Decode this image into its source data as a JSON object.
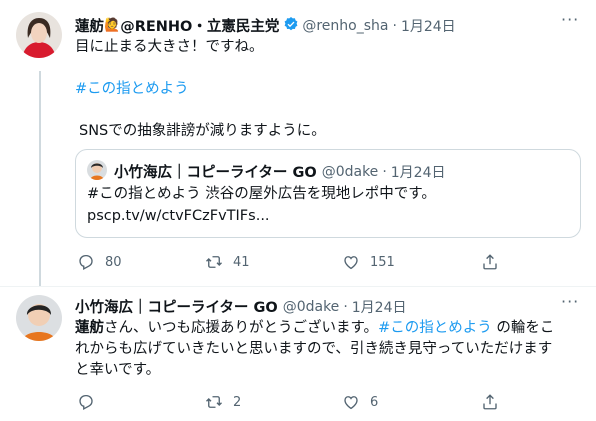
{
  "tweet1": {
    "display_name": "蓮舫",
    "name_emoji": "🙋",
    "party": "@RENHO・立憲民主党",
    "handle": "@renho_sha",
    "date": "1月24日",
    "text_line1": "目に止まる大きさ！ですね。",
    "hashtag": "#この指とめよう",
    "text_line3": "SNSでの抽象誹謗が減りますように。",
    "quote": {
      "display_name": "小竹海広｜コピーライター GO",
      "handle": "@0dake",
      "date": "1月24日",
      "hashtag": "#この指とめよう",
      "text": " 渋谷の屋外広告を現地レポ中です。",
      "link": "pscp.tv/w/ctvFCzFvTIFs..."
    },
    "reply_count": "80",
    "retweet_count": "41",
    "like_count": "151"
  },
  "tweet2": {
    "display_name": "小竹海広｜コピーライター GO",
    "handle": "@0dake",
    "date": "1月24日",
    "mention": "蓮舫",
    "text_a": "さん、いつも応援ありがとうございます。",
    "hashtag": "#この指とめよう",
    "text_b": " の輪をこ",
    "line2": "れからも広げていきたいと思いますので、引き続き見守っていただけます",
    "line3": "と幸いです。",
    "reply_count": "",
    "retweet_count": "2",
    "like_count": "6"
  },
  "colors": {
    "accent": "#1d9bf0",
    "muted": "#536471",
    "border": "#cfd9de"
  },
  "icons": [
    "verified-badge-icon",
    "more-icon",
    "reply-icon",
    "retweet-icon",
    "like-icon",
    "share-icon"
  ]
}
